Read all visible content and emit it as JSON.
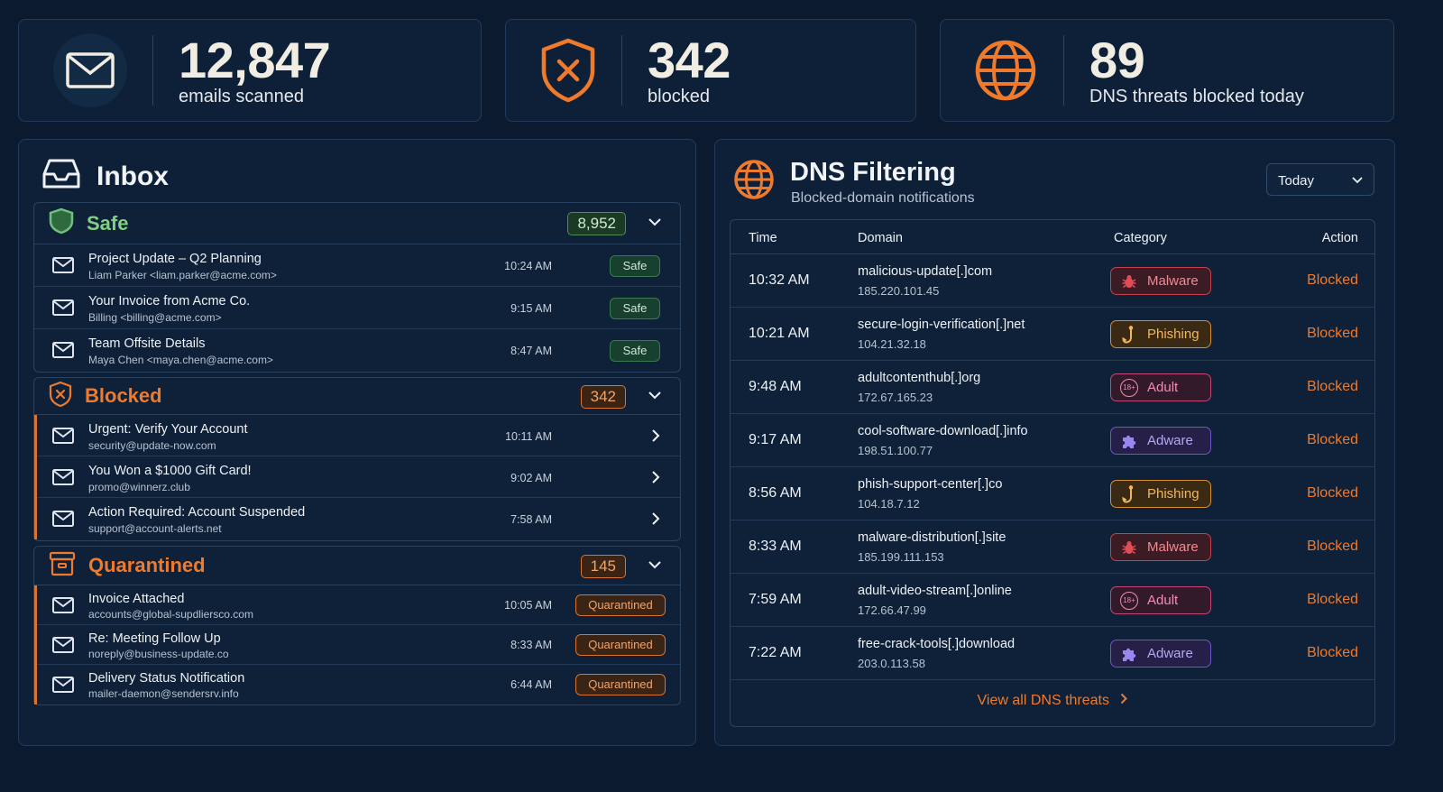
{
  "stats": {
    "emails": {
      "value": "12,847",
      "label": "emails scanned",
      "icon": "envelope-icon"
    },
    "blocked": {
      "value": "342",
      "label": "blocked",
      "icon": "shield-x-icon"
    },
    "dns": {
      "value": "89",
      "label": "DNS threats blocked today",
      "icon": "globe-icon"
    }
  },
  "inbox": {
    "title": "Inbox",
    "safe": {
      "name": "Safe",
      "count": "8,952",
      "items": [
        {
          "subject": "Project Update – Q2 Planning",
          "from": "Liam Parker <liam.parker@acme.com>",
          "time": "10:24 AM",
          "status": "Safe"
        },
        {
          "subject": "Your Invoice from Acme Co.",
          "from": "Billing <billing@acme.com>",
          "time": "9:15 AM",
          "status": "Safe"
        },
        {
          "subject": "Team Offsite Details",
          "from": "Maya Chen <maya.chen@acme.com>",
          "time": "8:47 AM",
          "status": "Safe"
        }
      ]
    },
    "blocked": {
      "name": "Blocked",
      "count": "342",
      "items": [
        {
          "subject": "Urgent: Verify Your Account",
          "from": "security@update-now.com",
          "time": "10:11 AM"
        },
        {
          "subject": "You Won a $1000 Gift Card!",
          "from": "promo@winnerz.club",
          "time": "9:02 AM"
        },
        {
          "subject": "Action Required: Account Suspended",
          "from": "support@account-alerts.net",
          "time": "7:58 AM"
        }
      ]
    },
    "quarantined": {
      "name": "Quarantined",
      "count": "145",
      "items": [
        {
          "subject": "Invoice Attached",
          "from": "accounts@global-supdliersco.com",
          "time": "10:05 AM",
          "status": "Quarantined"
        },
        {
          "subject": "Re: Meeting Follow Up",
          "from": "noreply@business-update.co",
          "time": "8:33 AM",
          "status": "Quarantined"
        },
        {
          "subject": "Delivery Status Notification",
          "from": "mailer-daemon@sendersrv.info",
          "time": "6:44 AM",
          "status": "Quarantined"
        }
      ]
    }
  },
  "dns": {
    "title": "DNS Filtering",
    "subtitle": "Blocked-domain notifications",
    "range": "Today",
    "columns": {
      "time": "Time",
      "domain": "Domain",
      "category": "Category",
      "action": "Action"
    },
    "rows": [
      {
        "time": "10:32 AM",
        "domain": "malicious-update[.]com",
        "ip": "185.220.101.45",
        "category": "Malware",
        "action": "Blocked"
      },
      {
        "time": "10:21 AM",
        "domain": "secure-login-verification[.]net",
        "ip": "104.21.32.18",
        "category": "Phishing",
        "action": "Blocked"
      },
      {
        "time": "9:48 AM",
        "domain": "adultcontenthub[.]org",
        "ip": "172.67.165.23",
        "category": "Adult",
        "action": "Blocked"
      },
      {
        "time": "9:17 AM",
        "domain": "cool-software-download[.]info",
        "ip": "198.51.100.77",
        "category": "Adware",
        "action": "Blocked"
      },
      {
        "time": "8:56 AM",
        "domain": "phish-support-center[.]co",
        "ip": "104.18.7.12",
        "category": "Phishing",
        "action": "Blocked"
      },
      {
        "time": "8:33 AM",
        "domain": "malware-distribution[.]site",
        "ip": "185.199.111.153",
        "category": "Malware",
        "action": "Blocked"
      },
      {
        "time": "7:59 AM",
        "domain": "adult-video-stream[.]online",
        "ip": "172.66.47.99",
        "category": "Adult",
        "action": "Blocked"
      },
      {
        "time": "7:22 AM",
        "domain": "free-crack-tools[.]download",
        "ip": "203.0.113.58",
        "category": "Adware",
        "action": "Blocked"
      }
    ],
    "view_all": "View all DNS threats",
    "adult_badge": "18+"
  },
  "colors": {
    "background": "#0b1a2e",
    "accent": "#f07a2b",
    "safe": "#6fc07a"
  }
}
